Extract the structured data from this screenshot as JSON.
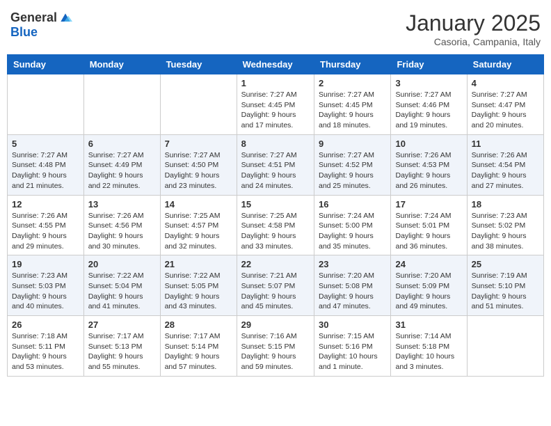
{
  "header": {
    "logo_general": "General",
    "logo_blue": "Blue",
    "month": "January 2025",
    "location": "Casoria, Campania, Italy"
  },
  "weekdays": [
    "Sunday",
    "Monday",
    "Tuesday",
    "Wednesday",
    "Thursday",
    "Friday",
    "Saturday"
  ],
  "weeks": [
    [
      {
        "day": "",
        "empty": true
      },
      {
        "day": "",
        "empty": true
      },
      {
        "day": "",
        "empty": true
      },
      {
        "day": "1",
        "sunrise": "7:27 AM",
        "sunset": "4:45 PM",
        "daylight": "9 hours and 17 minutes."
      },
      {
        "day": "2",
        "sunrise": "7:27 AM",
        "sunset": "4:45 PM",
        "daylight": "9 hours and 18 minutes."
      },
      {
        "day": "3",
        "sunrise": "7:27 AM",
        "sunset": "4:46 PM",
        "daylight": "9 hours and 19 minutes."
      },
      {
        "day": "4",
        "sunrise": "7:27 AM",
        "sunset": "4:47 PM",
        "daylight": "9 hours and 20 minutes."
      }
    ],
    [
      {
        "day": "5",
        "sunrise": "7:27 AM",
        "sunset": "4:48 PM",
        "daylight": "9 hours and 21 minutes."
      },
      {
        "day": "6",
        "sunrise": "7:27 AM",
        "sunset": "4:49 PM",
        "daylight": "9 hours and 22 minutes."
      },
      {
        "day": "7",
        "sunrise": "7:27 AM",
        "sunset": "4:50 PM",
        "daylight": "9 hours and 23 minutes."
      },
      {
        "day": "8",
        "sunrise": "7:27 AM",
        "sunset": "4:51 PM",
        "daylight": "9 hours and 24 minutes."
      },
      {
        "day": "9",
        "sunrise": "7:27 AM",
        "sunset": "4:52 PM",
        "daylight": "9 hours and 25 minutes."
      },
      {
        "day": "10",
        "sunrise": "7:26 AM",
        "sunset": "4:53 PM",
        "daylight": "9 hours and 26 minutes."
      },
      {
        "day": "11",
        "sunrise": "7:26 AM",
        "sunset": "4:54 PM",
        "daylight": "9 hours and 27 minutes."
      }
    ],
    [
      {
        "day": "12",
        "sunrise": "7:26 AM",
        "sunset": "4:55 PM",
        "daylight": "9 hours and 29 minutes."
      },
      {
        "day": "13",
        "sunrise": "7:26 AM",
        "sunset": "4:56 PM",
        "daylight": "9 hours and 30 minutes."
      },
      {
        "day": "14",
        "sunrise": "7:25 AM",
        "sunset": "4:57 PM",
        "daylight": "9 hours and 32 minutes."
      },
      {
        "day": "15",
        "sunrise": "7:25 AM",
        "sunset": "4:58 PM",
        "daylight": "9 hours and 33 minutes."
      },
      {
        "day": "16",
        "sunrise": "7:24 AM",
        "sunset": "5:00 PM",
        "daylight": "9 hours and 35 minutes."
      },
      {
        "day": "17",
        "sunrise": "7:24 AM",
        "sunset": "5:01 PM",
        "daylight": "9 hours and 36 minutes."
      },
      {
        "day": "18",
        "sunrise": "7:23 AM",
        "sunset": "5:02 PM",
        "daylight": "9 hours and 38 minutes."
      }
    ],
    [
      {
        "day": "19",
        "sunrise": "7:23 AM",
        "sunset": "5:03 PM",
        "daylight": "9 hours and 40 minutes."
      },
      {
        "day": "20",
        "sunrise": "7:22 AM",
        "sunset": "5:04 PM",
        "daylight": "9 hours and 41 minutes."
      },
      {
        "day": "21",
        "sunrise": "7:22 AM",
        "sunset": "5:05 PM",
        "daylight": "9 hours and 43 minutes."
      },
      {
        "day": "22",
        "sunrise": "7:21 AM",
        "sunset": "5:07 PM",
        "daylight": "9 hours and 45 minutes."
      },
      {
        "day": "23",
        "sunrise": "7:20 AM",
        "sunset": "5:08 PM",
        "daylight": "9 hours and 47 minutes."
      },
      {
        "day": "24",
        "sunrise": "7:20 AM",
        "sunset": "5:09 PM",
        "daylight": "9 hours and 49 minutes."
      },
      {
        "day": "25",
        "sunrise": "7:19 AM",
        "sunset": "5:10 PM",
        "daylight": "9 hours and 51 minutes."
      }
    ],
    [
      {
        "day": "26",
        "sunrise": "7:18 AM",
        "sunset": "5:11 PM",
        "daylight": "9 hours and 53 minutes."
      },
      {
        "day": "27",
        "sunrise": "7:17 AM",
        "sunset": "5:13 PM",
        "daylight": "9 hours and 55 minutes."
      },
      {
        "day": "28",
        "sunrise": "7:17 AM",
        "sunset": "5:14 PM",
        "daylight": "9 hours and 57 minutes."
      },
      {
        "day": "29",
        "sunrise": "7:16 AM",
        "sunset": "5:15 PM",
        "daylight": "9 hours and 59 minutes."
      },
      {
        "day": "30",
        "sunrise": "7:15 AM",
        "sunset": "5:16 PM",
        "daylight": "10 hours and 1 minute."
      },
      {
        "day": "31",
        "sunrise": "7:14 AM",
        "sunset": "5:18 PM",
        "daylight": "10 hours and 3 minutes."
      },
      {
        "day": "",
        "empty": true
      }
    ]
  ],
  "labels": {
    "sunrise": "Sunrise:",
    "sunset": "Sunset:",
    "daylight": "Daylight:"
  }
}
